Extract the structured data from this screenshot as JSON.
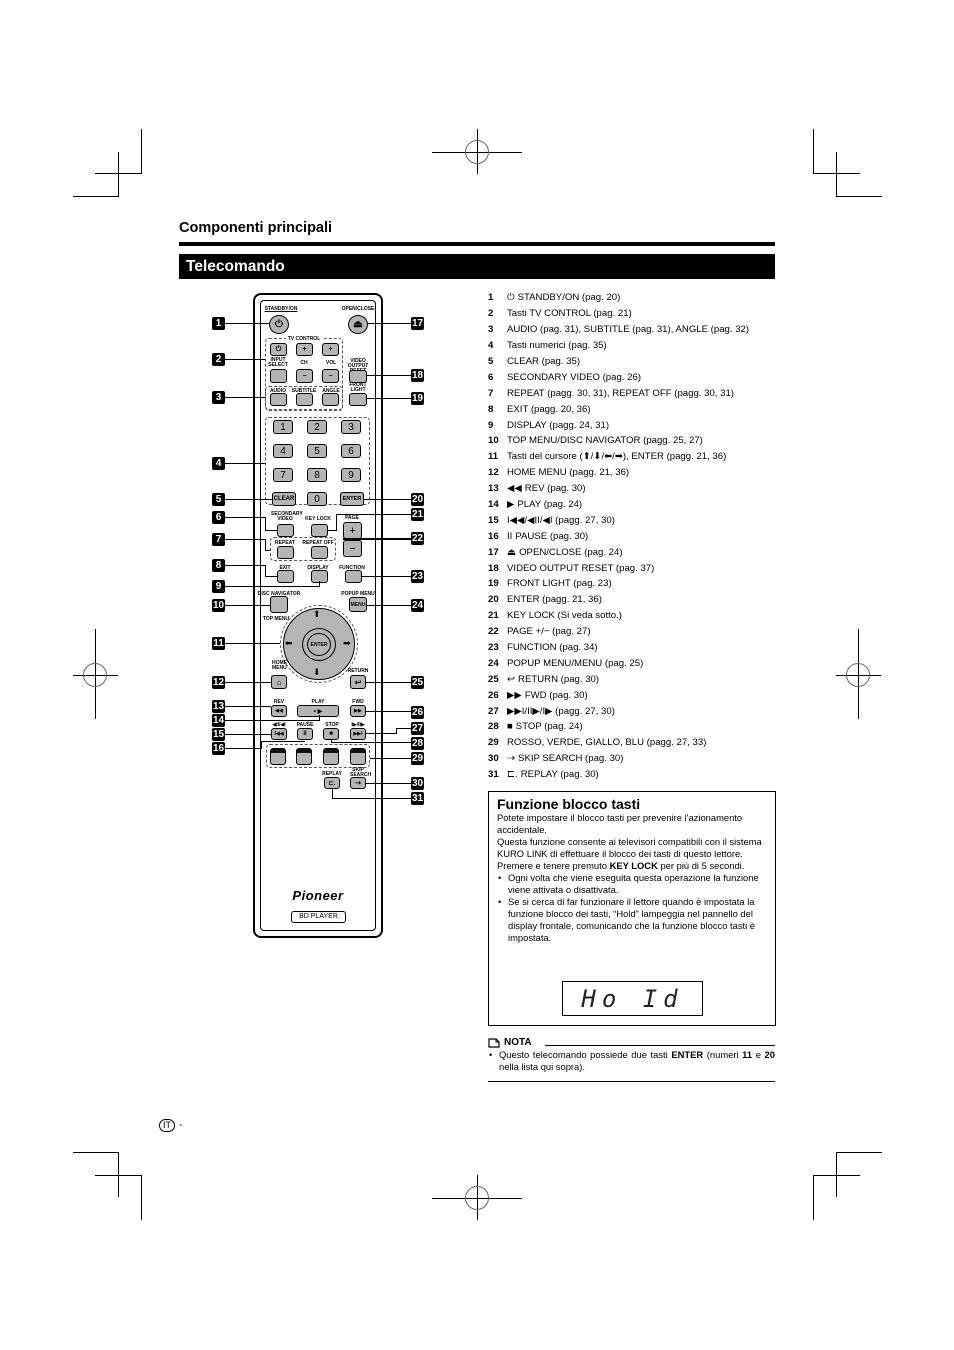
{
  "header": {
    "section_title": "Componenti principali",
    "banner_title": "Telecomando"
  },
  "remote": {
    "labels": {
      "standby": "STANDBY/ON",
      "open_close": "OPEN/CLOSE",
      "tv_control": "TV CONTROL",
      "input_select": "INPUT SELECT",
      "ch": "CH",
      "vol": "VOL",
      "video_output_reset": "VIDEO OUTPUT RESET",
      "audio": "AUDIO",
      "subtitle": "SUBTITLE",
      "angle": "ANGLE",
      "front_light": "FRONT LIGHT",
      "clear": "CLEAR",
      "enter": "ENTER",
      "secondary_video": "SECONDARY VIDEO",
      "key_lock": "KEY LOCK",
      "page": "PAGE",
      "repeat": "REPEAT",
      "repeat_off": "REPEAT OFF",
      "exit": "EXIT",
      "display": "DISPLAY",
      "function": "FUNCTION",
      "disc_navigator": "DISC NAVIGATOR",
      "top_menu": "TOP MENU",
      "popup_menu": "POPUP MENU",
      "menu": "MENU",
      "home_menu": "HOME MENU",
      "return": "RETURN",
      "rev": "REV",
      "play": "PLAY",
      "fwd": "FWD",
      "prev": "◀II/◀I",
      "pause": "PAUSE",
      "stop": "STOP",
      "next": "I▶/II▶",
      "replay": "REPLAY",
      "skip_search": "SKIP SEARCH",
      "brand": "Pioneer",
      "model": "BD PLAYER"
    },
    "glyphs": {
      "power": "⏻",
      "eject": "⏏",
      "plus": "+",
      "minus": "−",
      "up": "⬆",
      "down": "⬇",
      "left": "⬅",
      "right": "➡",
      "home": "⌂",
      "return": "↩",
      "rev": "◀◀",
      "play": "•  ▶",
      "fwd": "▶▶",
      "prev": "I◀◀",
      "pause": "II",
      "stop": "■",
      "next": "▶▶I",
      "replay": "⊏.",
      "skip": "⇢"
    },
    "numbers": [
      "1",
      "2",
      "3",
      "4",
      "5",
      "6",
      "7",
      "8",
      "9",
      "0"
    ],
    "callouts": [
      "1",
      "2",
      "3",
      "4",
      "5",
      "6",
      "7",
      "8",
      "9",
      "10",
      "11",
      "12",
      "13",
      "14",
      "15",
      "16",
      "17",
      "18",
      "19",
      "20",
      "21",
      "22",
      "23",
      "24",
      "25",
      "26",
      "27",
      "28",
      "29",
      "30",
      "31"
    ]
  },
  "list": [
    {
      "num": "1",
      "icon": "⏻",
      "text": "STANDBY/ON (pag. 20)"
    },
    {
      "num": "2",
      "icon": "",
      "text": "Tasti TV CONTROL (pag. 21)"
    },
    {
      "num": "3",
      "icon": "",
      "text": "AUDIO (pag. 31), SUBTITLE (pag. 31), ANGLE (pag. 32)"
    },
    {
      "num": "4",
      "icon": "",
      "text": "Tasti numerici (pag. 35)"
    },
    {
      "num": "5",
      "icon": "",
      "text": "CLEAR (pag. 35)"
    },
    {
      "num": "6",
      "icon": "",
      "text": "SECONDARY VIDEO (pag. 26)"
    },
    {
      "num": "7",
      "icon": "",
      "text": "REPEAT (pagg. 30, 31), REPEAT OFF (pagg. 30, 31)"
    },
    {
      "num": "8",
      "icon": "",
      "text": "EXIT (pagg. 20, 36)"
    },
    {
      "num": "9",
      "icon": "",
      "text": "DISPLAY (pagg. 24, 31)"
    },
    {
      "num": "10",
      "icon": "",
      "text": "TOP MENU/DISC NAVIGATOR (pagg. 25, 27)"
    },
    {
      "num": "11",
      "icon": "",
      "text": "Tasti del cursore (⬆/⬇/⬅/➡), ENTER (pagg. 21, 36)"
    },
    {
      "num": "12",
      "icon": "",
      "text": "HOME MENU (pagg. 21, 36)"
    },
    {
      "num": "13",
      "icon": "◀◀",
      "text": "REV (pag. 30)"
    },
    {
      "num": "14",
      "icon": "▶",
      "text": "PLAY (pag. 24)"
    },
    {
      "num": "15",
      "icon": "",
      "text": "I◀◀/◀II/◀I (pagg. 27, 30)"
    },
    {
      "num": "16",
      "icon": "II",
      "text": "PAUSE (pag. 30)"
    },
    {
      "num": "17",
      "icon": "⏏",
      "text": "OPEN/CLOSE (pag. 24)"
    },
    {
      "num": "18",
      "icon": "",
      "text": "VIDEO OUTPUT RESET (pag. 37)"
    },
    {
      "num": "19",
      "icon": "",
      "text": "FRONT LIGHT (pag. 23)"
    },
    {
      "num": "20",
      "icon": "",
      "text": "ENTER (pagg. 21, 36)"
    },
    {
      "num": "21",
      "icon": "",
      "text": "KEY LOCK (Si veda sotto.)"
    },
    {
      "num": "22",
      "icon": "",
      "text": "PAGE +/− (pag. 27)"
    },
    {
      "num": "23",
      "icon": "",
      "text": "FUNCTION (pag. 34)"
    },
    {
      "num": "24",
      "icon": "",
      "text": "POPUP MENU/MENU (pag. 25)"
    },
    {
      "num": "25",
      "icon": "↩",
      "text": "RETURN (pag. 30)"
    },
    {
      "num": "26",
      "icon": "▶▶",
      "text": "FWD (pag. 30)"
    },
    {
      "num": "27",
      "icon": "",
      "text": "▶▶I/II▶/I▶ (pagg. 27, 30)"
    },
    {
      "num": "28",
      "icon": "■",
      "text": "STOP (pag. 24)"
    },
    {
      "num": "29",
      "icon": "",
      "text": "ROSSO, VERDE, GIALLO, BLU (pagg. 27, 33)"
    },
    {
      "num": "30",
      "icon": "⇢",
      "text": "SKIP SEARCH (pag. 30)"
    },
    {
      "num": "31",
      "icon": "⊏.",
      "text": "REPLAY (pag. 30)"
    }
  ],
  "key_lock_box": {
    "title": "Funzione blocco tasti",
    "p1": "Potete impostare il blocco tasti per prevenire l'azionamento accidentale.",
    "p2": "Questa funzione consente ai televisori compatibili con il sistema KURO LINK di effettuare il blocco dei tasti di questo lettore.",
    "p3_before": "Premere e tenere premuto ",
    "p3_bold": "KEY LOCK",
    "p3_after": " per più di 5 secondi.",
    "bullets": [
      "Ogni volta che viene eseguita questa operazione la funzione viene attivata o disattivata.",
      "Se si cerca di far funzionare il lettore quando è impostata la funzione blocco dei tasti, “Hold” lampeggia nel pannello del display frontale, comunicando che la funzione blocco tasti è impostata."
    ],
    "display_text": "Ho Id"
  },
  "nota": {
    "title": "NOTA",
    "before": "Questo telecomando possiede due tasti ",
    "bold1": "ENTER",
    "mid1": " (numeri ",
    "bold2": "11",
    "mid2": " e ",
    "bold3": "20",
    "after": " nella lista qui sopra)."
  },
  "footer": {
    "lang": "IT",
    "dash": "-"
  }
}
